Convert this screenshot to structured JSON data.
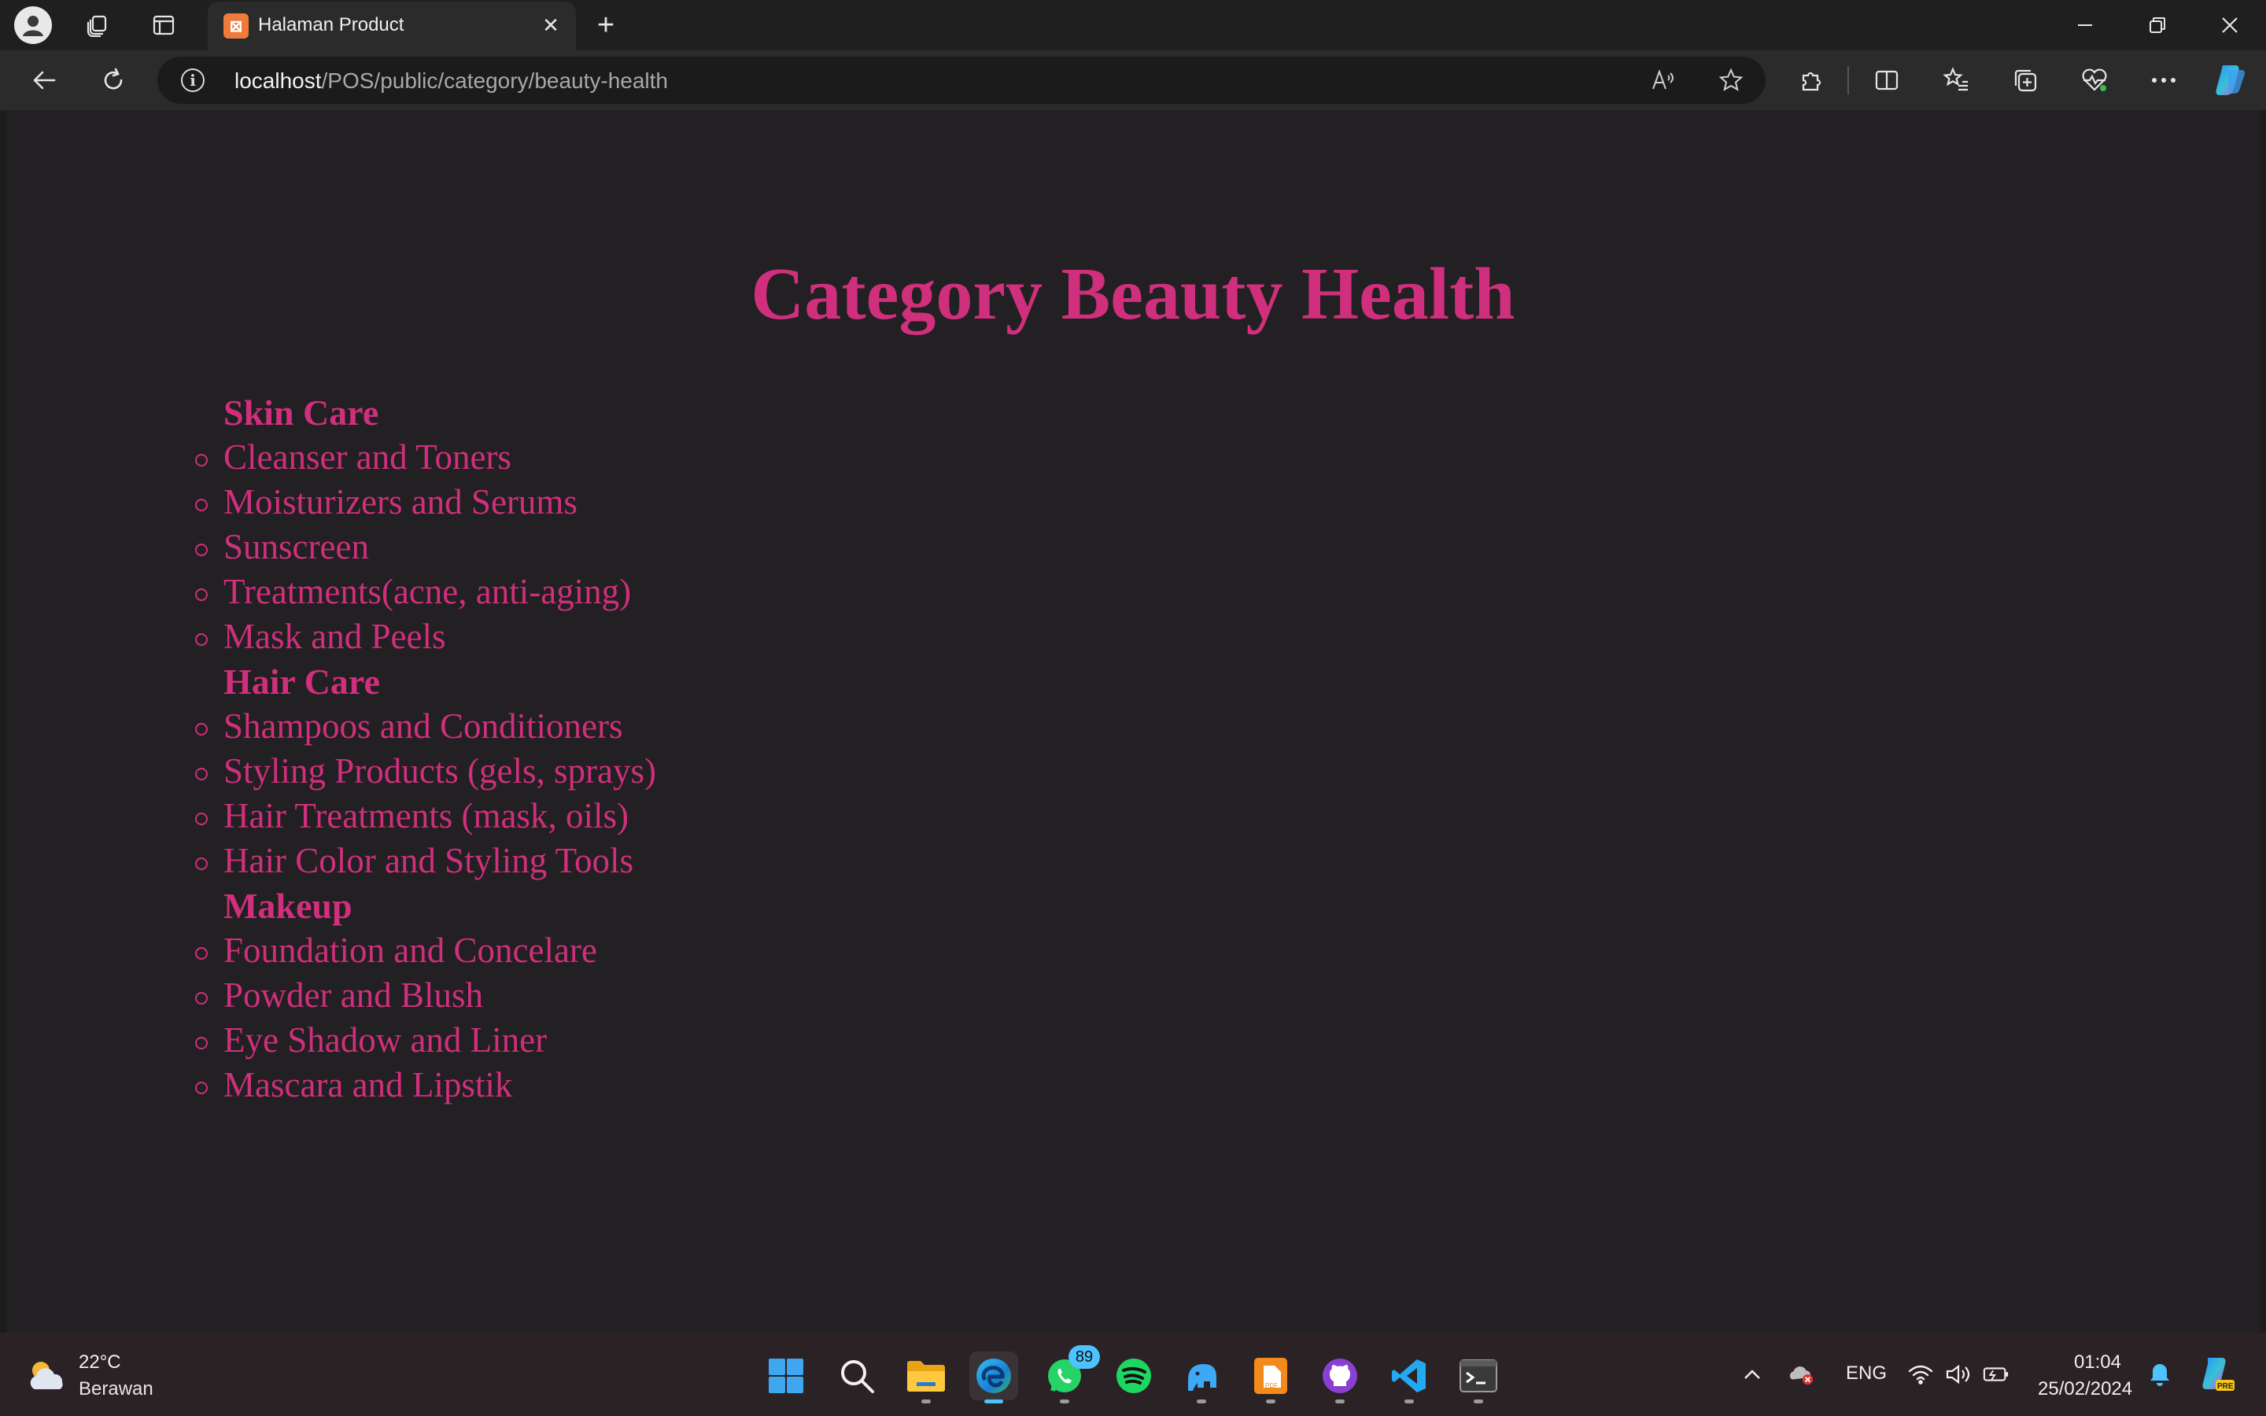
{
  "browser": {
    "tab_title": "Halaman Product",
    "url_host": "localhost",
    "url_path": "/POS/public/category/beauty-health"
  },
  "page": {
    "title": "Category Beauty Health",
    "categories": [
      {
        "name": "Skin Care",
        "items": [
          "Cleanser and Toners",
          "Moisturizers and Serums",
          "Sunscreen",
          "Treatments(acne, anti-aging)",
          "Mask and Peels"
        ]
      },
      {
        "name": "Hair Care",
        "items": [
          "Shampoos and Conditioners",
          "Styling Products (gels, sprays)",
          "Hair Treatments (mask, oils)",
          "Hair Color and Styling Tools"
        ]
      },
      {
        "name": "Makeup",
        "items": [
          "Foundation and Concelare",
          "Powder and Blush",
          "Eye Shadow and Liner",
          "Mascara and Lipstik"
        ]
      }
    ]
  },
  "taskbar": {
    "weather_temp": "22°C",
    "weather_desc": "Berawan",
    "whatsapp_badge": "89",
    "language": "ENG",
    "time": "01:04",
    "date": "25/02/2024"
  },
  "colors": {
    "accent": "#cf2f7c",
    "page_bg": "#222022",
    "taskbar_bg": "#2a2224"
  },
  "icons": [
    "profile-icon",
    "workspaces-icon",
    "tab-actions-icon",
    "xampp-favicon",
    "close-icon",
    "plus-icon",
    "minimize-icon",
    "restore-icon",
    "back-icon",
    "refresh-icon",
    "info-icon",
    "read-aloud-icon",
    "favorite-star-icon",
    "extensions-icon",
    "split-screen-icon",
    "favorites-icon",
    "collections-icon",
    "browser-essentials-icon",
    "more-icon",
    "copilot-icon",
    "weather-icon",
    "windows-start-icon",
    "search-icon",
    "file-explorer-icon",
    "edge-icon",
    "whatsapp-icon",
    "spotify-icon",
    "elephant-app-icon",
    "pdf-app-icon",
    "github-icon",
    "vscode-icon",
    "terminal-icon",
    "chevron-up-icon",
    "onedrive-icon",
    "wifi-icon",
    "volume-icon",
    "battery-icon",
    "notification-bell-icon"
  ]
}
